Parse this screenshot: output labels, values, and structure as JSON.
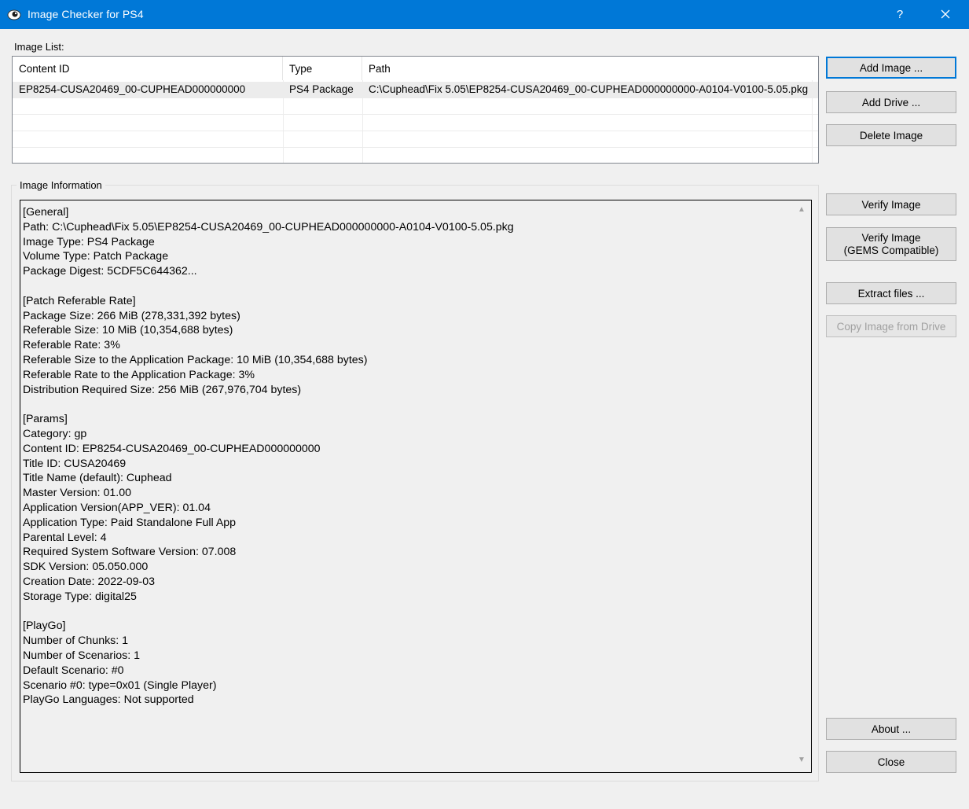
{
  "window": {
    "title": "Image Checker for PS4",
    "help_glyph": "?",
    "close_glyph": "✕",
    "icon": "app-eye-icon",
    "titlebar_color": "#0078d7"
  },
  "image_list": {
    "label": "Image List:",
    "columns": [
      "Content ID",
      "Type",
      "Path"
    ],
    "rows": [
      {
        "content_id": "EP8254-CUSA20469_00-CUPHEAD000000000",
        "type": "PS4 Package",
        "path": "C:\\Cuphead\\Fix 5.05\\EP8254-CUSA20469_00-CUPHEAD000000000-A0104-V0100-5.05.pkg"
      }
    ]
  },
  "image_information": {
    "label": "Image Information",
    "text": "[General]\nPath: C:\\Cuphead\\Fix 5.05\\EP8254-CUSA20469_00-CUPHEAD000000000-A0104-V0100-5.05.pkg\nImage Type: PS4 Package\nVolume Type: Patch Package\nPackage Digest: 5CDF5C644362...\n\n[Patch Referable Rate]\nPackage Size: 266 MiB (278,331,392 bytes)\nReferable Size: 10 MiB (10,354,688 bytes)\nReferable Rate: 3%\nReferable Size to the Application Package: 10 MiB (10,354,688 bytes)\nReferable Rate to the Application Package: 3%\nDistribution Required Size: 256 MiB (267,976,704 bytes)\n\n[Params]\nCategory: gp\nContent ID: EP8254-CUSA20469_00-CUPHEAD000000000\nTitle ID: CUSA20469\nTitle Name (default): Cuphead\nMaster Version: 01.00\nApplication Version(APP_VER): 01.04\nApplication Type: Paid Standalone Full App\nParental Level: 4\nRequired System Software Version: 07.008\nSDK Version: 05.050.000\nCreation Date: 2022-09-03\nStorage Type: digital25\n\n[PlayGo]\nNumber of Chunks: 1\nNumber of Scenarios: 1\nDefault Scenario: #0\nScenario #0: type=0x01 (Single Player)\nPlayGo Languages: Not supported"
  },
  "buttons": {
    "add_image": "Add Image ...",
    "add_drive": "Add Drive ...",
    "delete_image": "Delete Image",
    "verify_image": "Verify Image",
    "verify_gems_line1": "Verify Image",
    "verify_gems_line2": "(GEMS Compatible)",
    "extract_files": "Extract files ...",
    "copy_from_drive": "Copy Image from Drive",
    "about": "About ...",
    "close": "Close"
  },
  "scroll": {
    "up_glyph": "▲",
    "down_glyph": "▼"
  }
}
